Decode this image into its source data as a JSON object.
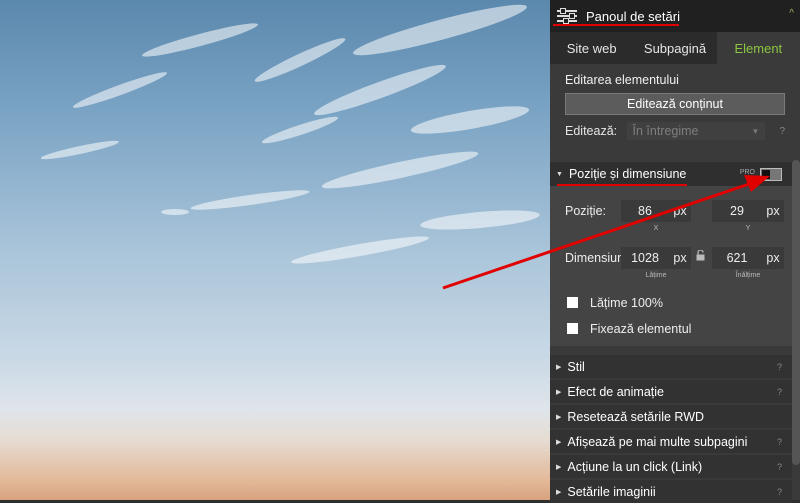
{
  "panel": {
    "title": "Panoul de setări",
    "tabs": [
      {
        "label": "Site web",
        "active": false
      },
      {
        "label": "Subpagină",
        "active": false
      },
      {
        "label": "Element",
        "active": true
      }
    ],
    "section_title": "Editarea elementului",
    "edit_content_button": "Editează conținut",
    "edit_label": "Editează:",
    "edit_select_value": "În întregime",
    "help_mark": "?",
    "position_group": {
      "title": "Poziție și dimensiune",
      "pro_label": "PRO",
      "position_label": "Poziție:",
      "x_value": "86",
      "y_value": "29",
      "x_caption": "X",
      "y_caption": "Y",
      "size_label": "Dimensiune:",
      "width_value": "1028",
      "height_value": "621",
      "width_caption": "Lățime",
      "height_caption": "Înălțime",
      "unit": "px",
      "full_width_label": "Lățime 100%",
      "fix_element_label": "Fixează elementul"
    },
    "collapsed_sections": [
      {
        "label": "Stil",
        "help": "?"
      },
      {
        "label": "Efect de animație",
        "help": "?"
      },
      {
        "label": "Resetează setările RWD",
        "help": ""
      },
      {
        "label": "Afișează pe mai multe subpagini",
        "help": "?"
      },
      {
        "label": "Acțiune la un click (Link)",
        "help": "?"
      },
      {
        "label": "Setările imaginii",
        "help": "?"
      }
    ]
  },
  "colors": {
    "accent": "#8cc63f",
    "annotation": "#e10000",
    "panel_bg": "#3a3a3a",
    "header_bg": "#202020"
  }
}
